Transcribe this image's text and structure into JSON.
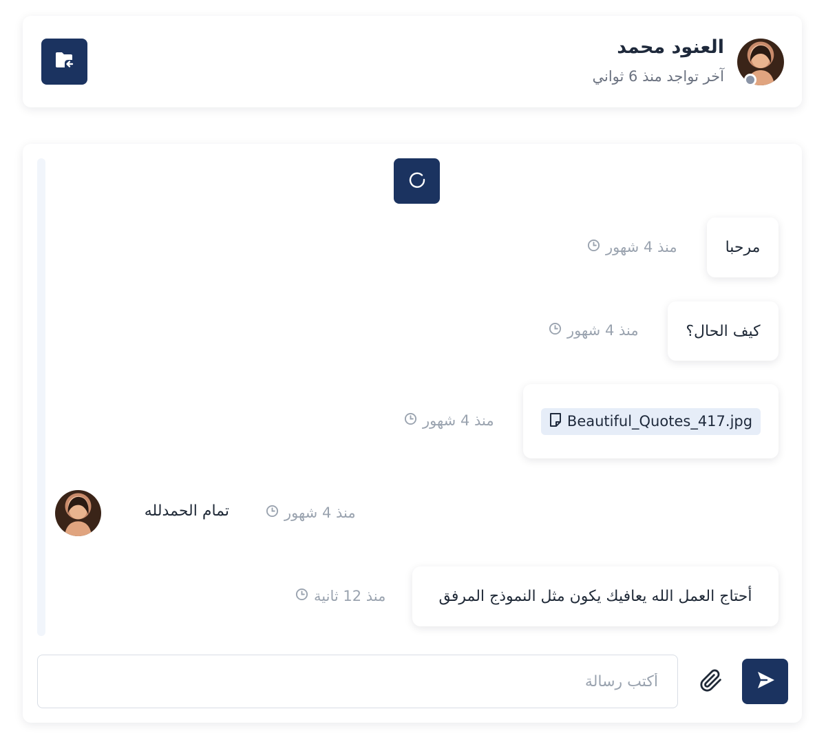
{
  "header": {
    "contact_name": "العنود محمد",
    "last_seen": "آخر تواجد منذ 6 ثواني",
    "status_color": "#8a94a6",
    "files_icon": "folder-share-icon"
  },
  "chat": {
    "load_more_icon": "refresh-icon",
    "messages": [
      {
        "text": "مرحبا",
        "time": "منذ 4 شهور",
        "sender": "self"
      },
      {
        "text": "كيف الحال؟",
        "time": "منذ 4 شهور",
        "sender": "self"
      },
      {
        "file_name": "Beautiful_Quotes_417.jpg",
        "time": "منذ 4 شهور",
        "sender": "self"
      },
      {
        "text": "تمام الحمدلله",
        "time": "منذ 4 شهور",
        "sender": "contact"
      },
      {
        "text": "أحتاج العمل الله يعافيك يكون مثل النموذج المرفق",
        "time": "منذ 12 ثانية",
        "sender": "self"
      }
    ]
  },
  "composer": {
    "placeholder": "أكتب رسالة",
    "value": "",
    "attach_icon": "paperclip-icon",
    "send_icon": "send-icon"
  },
  "colors": {
    "accent": "#1b3360",
    "file_chip_bg": "#e6edf8",
    "timestamp": "#9aa3af"
  }
}
